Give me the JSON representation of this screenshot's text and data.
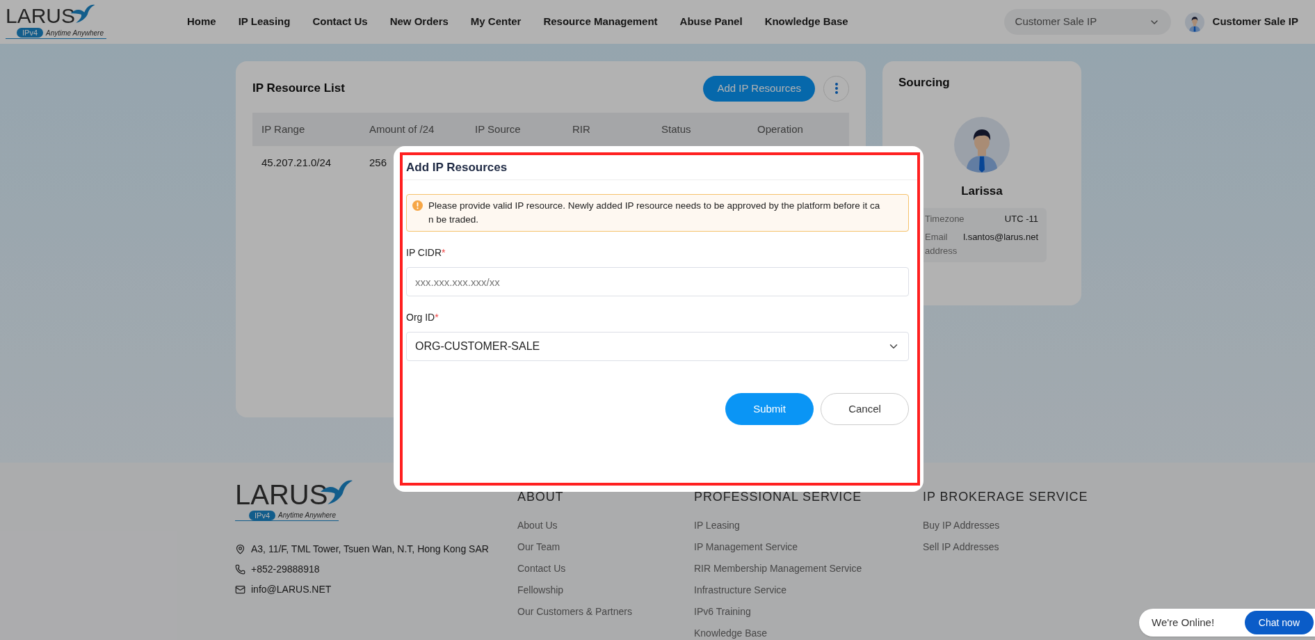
{
  "header": {
    "logo": {
      "name": "LARUS",
      "badge": "IPv4",
      "tagline": "Anytime Anywhere"
    },
    "nav": [
      "Home",
      "IP Leasing",
      "Contact Us",
      "New Orders",
      "My Center",
      "Resource Management",
      "Abuse Panel",
      "Knowledge Base"
    ],
    "account_select": "Customer Sale IP",
    "user_name": "Customer Sale IP"
  },
  "resource_list": {
    "title": "IP Resource List",
    "add_button": "Add IP Resources",
    "columns": [
      "IP Range",
      "Amount of /24",
      "IP Source",
      "RIR",
      "Status",
      "Operation"
    ],
    "rows": [
      [
        "45.207.21.0/24",
        "256"
      ]
    ]
  },
  "sourcing": {
    "title": "Sourcing",
    "name": "Larissa",
    "fields": [
      {
        "label": "Timezone",
        "value": "UTC -11"
      },
      {
        "label": "Email address",
        "value": "l.santos@larus.net"
      }
    ]
  },
  "dialog": {
    "title": "Add IP Resources",
    "alert_lines": [
      "Please provide valid IP resource. Newly added IP resource needs to be approved by the platform before it ca",
      "n be traded."
    ],
    "fields": [
      {
        "kind": "input",
        "label": "IP CIDR",
        "required_mark": "*",
        "placeholder": "xxx.xxx.xxx.xxx/xx"
      },
      {
        "kind": "select",
        "label": "Org ID",
        "required_mark": "*",
        "value": "ORG-CUSTOMER-SALE"
      }
    ],
    "submit": "Submit",
    "cancel": "Cancel"
  },
  "footer": {
    "logo": {
      "name": "LARUS",
      "badge": "IPv4",
      "tagline": "Anytime Anywhere"
    },
    "contacts": [
      {
        "kind": "address",
        "text": "A3, 11/F, TML Tower, Tsuen Wan, N.T, Hong Kong SAR"
      },
      {
        "kind": "phone",
        "text": "+852-29888918"
      },
      {
        "kind": "email",
        "text": "info@LARUS.NET"
      }
    ],
    "columns": [
      {
        "title": "ABOUT",
        "links": [
          "About Us",
          "Our Team",
          "Contact Us",
          "Fellowship",
          "Our Customers & Partners"
        ]
      },
      {
        "title": "PROFESSIONAL SERVICE",
        "links": [
          "IP Leasing",
          "IP Management Service",
          "RIR Membership Management Service",
          "Infrastructure Service",
          "IPv6 Training",
          "Knowledge Base"
        ]
      },
      {
        "title": "IP BROKERAGE SERVICE",
        "links": [
          "Buy IP Addresses",
          "Sell IP Addresses"
        ]
      }
    ]
  },
  "chat": {
    "status": "We're Online!",
    "button": "Chat now"
  }
}
